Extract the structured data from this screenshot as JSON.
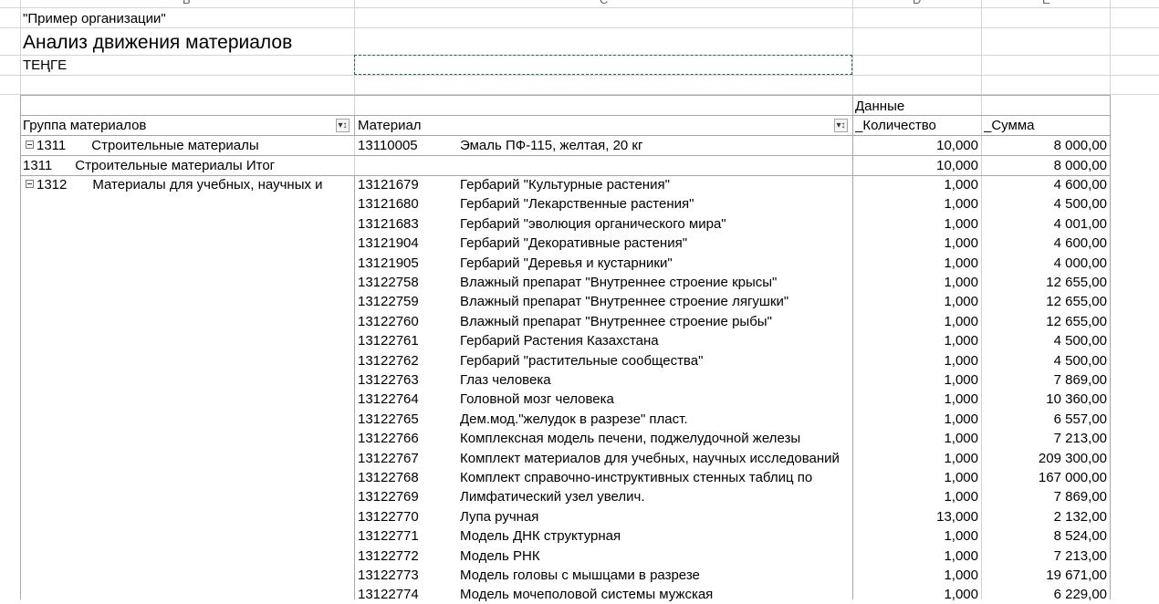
{
  "sheet": {
    "col_letters": [
      "B",
      "C",
      "D",
      "E"
    ],
    "org_name": "\"Пример организации\"",
    "report_title": "Анализ движения материалов",
    "currency": "ТЕҢГЕ"
  },
  "pivot": {
    "data_label": "Данные",
    "headers": {
      "group": "Группа материалов",
      "material": "Материал",
      "quantity": "_Количество",
      "sum": "_Сумма"
    },
    "group1": {
      "code": "1311",
      "name": "Строительные материалы",
      "rows": [
        {
          "code": "13110005",
          "name": "Эмаль ПФ-115, желтая, 20 кг",
          "qty": "10,000",
          "sum": "8 000,00"
        }
      ],
      "total_label": "1311      Строительные материалы Итог",
      "total_qty": "10,000",
      "total_sum": "8 000,00"
    },
    "group2": {
      "code": "1312",
      "name": "Материалы для учебных, научных и",
      "rows": [
        {
          "code": "13121679",
          "name": "Гербарий \"Культурные растения\"",
          "qty": "1,000",
          "sum": "4 600,00"
        },
        {
          "code": "13121680",
          "name": "Гербарий \"Лекарственные растения\"",
          "qty": "1,000",
          "sum": "4 500,00"
        },
        {
          "code": "13121683",
          "name": "Гербарий \"эволюция органического мира\"",
          "qty": "1,000",
          "sum": "4 001,00"
        },
        {
          "code": "13121904",
          "name": "Гербарий \"Декоративные растения\"",
          "qty": "1,000",
          "sum": "4 600,00"
        },
        {
          "code": "13121905",
          "name": "Гербарий \"Деревья и кустарники\"",
          "qty": "1,000",
          "sum": "4 000,00"
        },
        {
          "code": "13122758",
          "name": "Влажный препарат \"Внутреннее строение крысы\"",
          "qty": "1,000",
          "sum": "12 655,00"
        },
        {
          "code": "13122759",
          "name": "Влажный препарат \"Внутреннее строение лягушки\"",
          "qty": "1,000",
          "sum": "12 655,00"
        },
        {
          "code": "13122760",
          "name": "Влажный препарат \"Внутреннее строение рыбы\"",
          "qty": "1,000",
          "sum": "12 655,00"
        },
        {
          "code": "13122761",
          "name": "Гербарий  Растения Казахстана",
          "qty": "1,000",
          "sum": "4 500,00"
        },
        {
          "code": "13122762",
          "name": "Гербарий \"растительные сообщества\"",
          "qty": "1,000",
          "sum": "4 500,00"
        },
        {
          "code": "13122763",
          "name": "Глаз человека",
          "qty": "1,000",
          "sum": "7 869,00"
        },
        {
          "code": "13122764",
          "name": "Головной мозг человека",
          "qty": "1,000",
          "sum": "10 360,00"
        },
        {
          "code": "13122765",
          "name": "Дем.мод.\"желудок в разрезе\" пласт.",
          "qty": "1,000",
          "sum": "6 557,00"
        },
        {
          "code": "13122766",
          "name": "Комплексная  модель печени, поджелудочной железы",
          "qty": "1,000",
          "sum": "7 213,00"
        },
        {
          "code": "13122767",
          "name": "Комплект материалов для учебных, научных исследований",
          "qty": "1,000",
          "sum": "209 300,00"
        },
        {
          "code": "13122768",
          "name": "Комплект справочно-инструктивных стенных таблиц по",
          "qty": "1,000",
          "sum": "167 000,00"
        },
        {
          "code": "13122769",
          "name": "Лимфатический узел увелич.",
          "qty": "1,000",
          "sum": "7 869,00"
        },
        {
          "code": "13122770",
          "name": "Лупа ручная",
          "qty": "13,000",
          "sum": "2 132,00"
        },
        {
          "code": "13122771",
          "name": "Модель ДНК структурная",
          "qty": "1,000",
          "sum": "8 524,00"
        },
        {
          "code": "13122772",
          "name": "Модель РНК",
          "qty": "1,000",
          "sum": "7 213,00"
        },
        {
          "code": "13122773",
          "name": "Модель головы с мышцами в разрезе",
          "qty": "1,000",
          "sum": "19 671,00"
        },
        {
          "code": "13122774",
          "name": "Модель мочеполовой системы мужская",
          "qty": "1,000",
          "sum": "6 229,00"
        }
      ]
    }
  },
  "icons": {
    "filter_dropdown": "▾↕",
    "collapse": "minus-box"
  }
}
